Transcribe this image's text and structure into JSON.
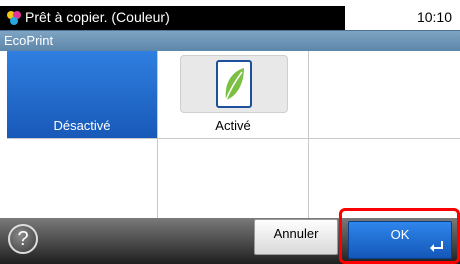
{
  "status": {
    "message": "Prêt à copier. (Couleur)",
    "time": "10:10",
    "icon": "printer-color-icon"
  },
  "screen": {
    "title": "EcoPrint"
  },
  "options": [
    {
      "label": "Désactivé",
      "selected": true
    },
    {
      "label": "Activé",
      "selected": false,
      "icon": "leaf-icon"
    }
  ],
  "footer": {
    "help_label": "?",
    "cancel_label": "Annuler",
    "ok_label": "OK",
    "ok_icon": "enter-icon"
  },
  "colors": {
    "selected": "#1f6ad1",
    "title_bar": "#6e95b8",
    "highlight": "#ff0000"
  }
}
